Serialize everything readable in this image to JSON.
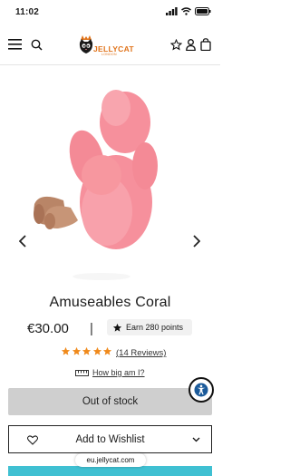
{
  "status_bar": {
    "time": "11:02"
  },
  "header": {
    "logo_text": "JELLYCAT",
    "logo_sub": "LONDON",
    "icons": [
      "menu-icon",
      "search-icon",
      "star-icon",
      "user-icon",
      "bag-icon"
    ]
  },
  "product": {
    "title": "Amuseables Coral",
    "price": "€30.00",
    "separator": "|",
    "points_label": "Earn 280 points",
    "rating": 5,
    "reviews_label": "(14 Reviews)",
    "size_link": "How big am I?",
    "out_of_stock_label": "Out of stock",
    "wishlist_label": "Add to Wishlist"
  },
  "browser": {
    "url": "eu.jellycat.com"
  },
  "colors": {
    "accent_orange": "#e0731a",
    "star_orange": "#f08a1c",
    "coral_pink": "#f6909c",
    "cta_teal": "#3fc0d2"
  }
}
